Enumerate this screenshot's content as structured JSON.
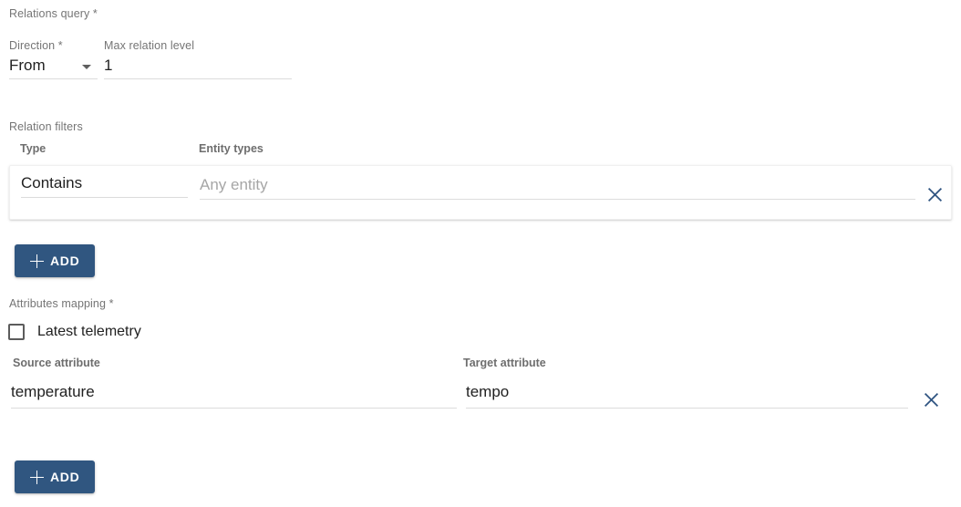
{
  "relations_query": {
    "section_label": "Relations query *",
    "direction": {
      "label": "Direction *",
      "value": "From",
      "arrow_icon": "chevron-down-icon"
    },
    "max_relation_level": {
      "label": "Max relation level",
      "value": "1"
    }
  },
  "relation_filters": {
    "section_label": "Relation filters",
    "columns": {
      "type": "Type",
      "entity_types": "Entity types"
    },
    "rows": [
      {
        "type": "Contains",
        "entity_types_value": "",
        "entity_types_placeholder": "Any entity",
        "remove_icon": "close-icon"
      }
    ],
    "add_button_label": "ADD",
    "add_button_icon": "plus-icon"
  },
  "attributes_mapping": {
    "section_label": "Attributes mapping *",
    "latest_telemetry": {
      "label": "Latest telemetry",
      "checked": false
    },
    "columns": {
      "source_attribute": "Source attribute",
      "target_attribute": "Target attribute"
    },
    "rows": [
      {
        "source": "temperature",
        "target": "tempo",
        "remove_icon": "close-icon"
      }
    ],
    "add_button_label": "ADD",
    "add_button_icon": "plus-icon"
  },
  "colors": {
    "accent": "#305680",
    "icon_accent": "#2f5481",
    "label_gray": "#757575",
    "underline": "#dcdcdc",
    "text": "#212121",
    "placeholder": "#a6a6a6"
  }
}
